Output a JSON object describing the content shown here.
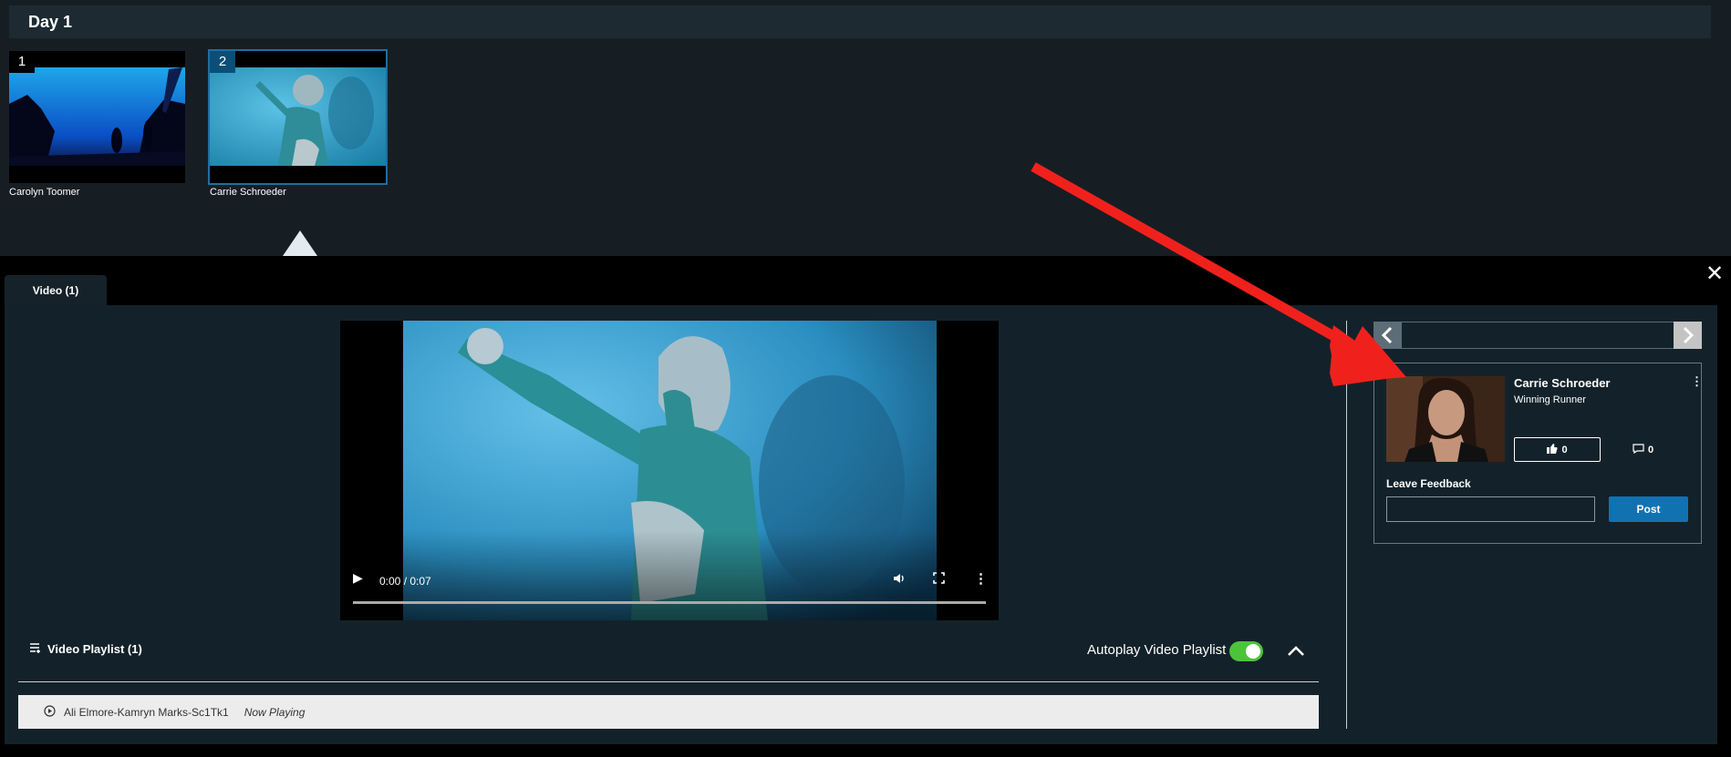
{
  "header": {
    "title": "Day 1"
  },
  "thumbnails": [
    {
      "number": "1",
      "name": "Carolyn Toomer"
    },
    {
      "number": "2",
      "name": "Carrie Schroeder"
    }
  ],
  "panel": {
    "tab_label": "Video (1)",
    "close_icon": "close-icon"
  },
  "player": {
    "time": "0:00 / 0:07",
    "icons": [
      "play-icon",
      "volume-icon",
      "fullscreen-icon",
      "more-vertical-icon"
    ]
  },
  "playlist": {
    "title": "Video Playlist (1)",
    "autoplay_label": "Autoplay Video Playlist",
    "autoplay_on": true,
    "items": [
      {
        "title": "Ali Elmore-Kamryn Marks-Sc1Tk1",
        "status": "Now Playing"
      }
    ]
  },
  "sidebar": {
    "name": "Carrie Schroeder",
    "role": "Winning Runner",
    "likes": "0",
    "comments": "0",
    "feedback_label": "Leave Feedback",
    "feedback_value": "",
    "post_label": "Post"
  },
  "colors": {
    "accent": "#1172b2",
    "toggle_on": "#4cc43a",
    "annotation_arrow": "#f0211c"
  }
}
